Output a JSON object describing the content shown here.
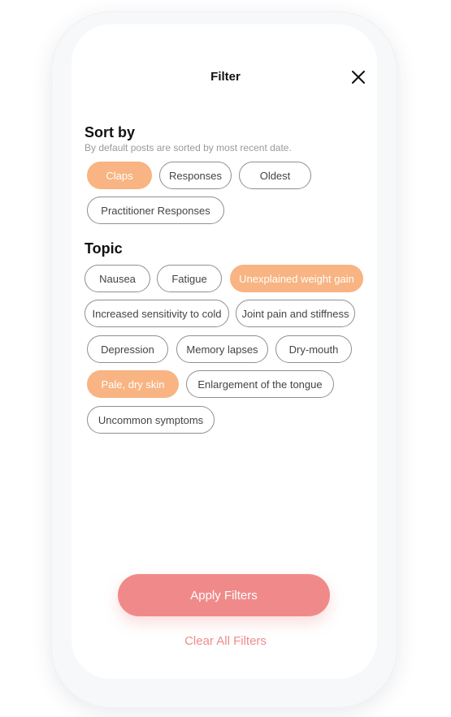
{
  "header": {
    "title": "Filter"
  },
  "sort": {
    "title": "Sort by",
    "subtitle": "By default posts are sorted by most recent date.",
    "options": [
      {
        "label": "Claps",
        "selected": true
      },
      {
        "label": "Responses",
        "selected": false
      },
      {
        "label": "Oldest",
        "selected": false
      },
      {
        "label": "Practitioner Responses",
        "selected": false
      }
    ]
  },
  "topic": {
    "title": "Topic",
    "options": [
      {
        "label": "Nausea",
        "selected": false
      },
      {
        "label": "Fatigue",
        "selected": false
      },
      {
        "label": "Unexplained weight gain",
        "selected": true
      },
      {
        "label": "Increased sensitivity to cold",
        "selected": false
      },
      {
        "label": "Joint pain and stiffness",
        "selected": false
      },
      {
        "label": "Depression",
        "selected": false
      },
      {
        "label": "Memory lapses",
        "selected": false
      },
      {
        "label": "Dry-mouth",
        "selected": false
      },
      {
        "label": "Pale, dry skin",
        "selected": true
      },
      {
        "label": "Enlargement of the tongue",
        "selected": false
      },
      {
        "label": "Uncommon symptoms",
        "selected": false
      }
    ]
  },
  "actions": {
    "apply_label": "Apply Filters",
    "clear_label": "Clear All Filters"
  },
  "colors": {
    "accent_orange": "#f8b482",
    "accent_coral": "#f08a8a"
  },
  "icons": {
    "close": "close-icon"
  }
}
